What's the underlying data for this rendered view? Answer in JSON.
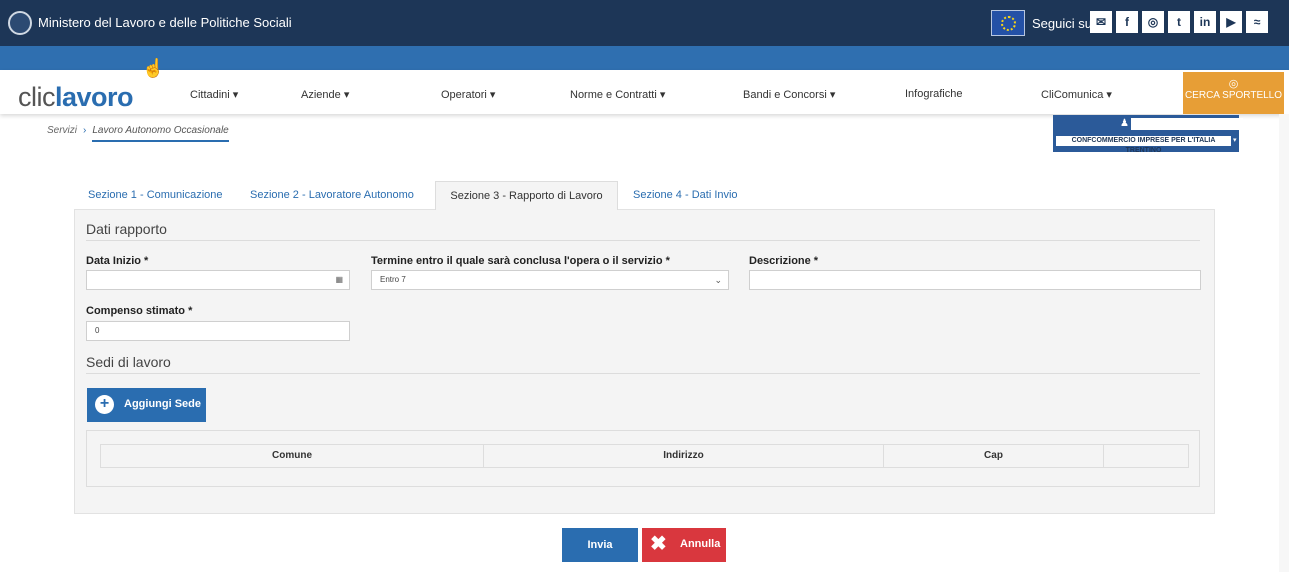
{
  "header": {
    "ministry": "Ministero del Lavoro e delle Politiche Sociali",
    "follow": "Seguici su:",
    "social_icons": [
      "mail-icon",
      "facebook-icon",
      "instagram-icon",
      "twitter-icon",
      "linkedin-icon",
      "youtube-icon",
      "rss-icon"
    ]
  },
  "brand": {
    "part1": "clic",
    "part2": "lavoro"
  },
  "nav": {
    "items": [
      "Cittadini",
      "Aziende",
      "Operatori",
      "Norme e Contratti",
      "Bandi e Concorsi",
      "Infografiche",
      "CliComunica"
    ],
    "sportello": "CERCA SPORTELLO"
  },
  "breadcrumb": {
    "root": "Servizi",
    "current": "Lavoro Autonomo Occasionale"
  },
  "user": {
    "org": "CONFCOMMERCIO IMPRESE PER L'ITALIA TRENTINO"
  },
  "tabs": [
    "Sezione 1 - Comunicazione",
    "Sezione 2 - Lavoratore Autonomo",
    "Sezione 3 - Rapporto di Lavoro",
    "Sezione 4 - Dati Invio"
  ],
  "form": {
    "section1": "Dati rapporto",
    "data_inizio_label": "Data Inizio *",
    "data_inizio_value": "",
    "termine_label": "Termine entro il quale sarà conclusa l'opera o il servizio *",
    "termine_value": "Entro 7",
    "descrizione_label": "Descrizione *",
    "descrizione_value": "",
    "compenso_label": "Compenso stimato *",
    "compenso_value": "0",
    "section2": "Sedi di lavoro",
    "add_button": "Aggiungi Sede",
    "table_headers": [
      "Comune",
      "Indirizzo",
      "Cap"
    ]
  },
  "actions": {
    "submit": "Invia",
    "cancel": "Annulla"
  }
}
